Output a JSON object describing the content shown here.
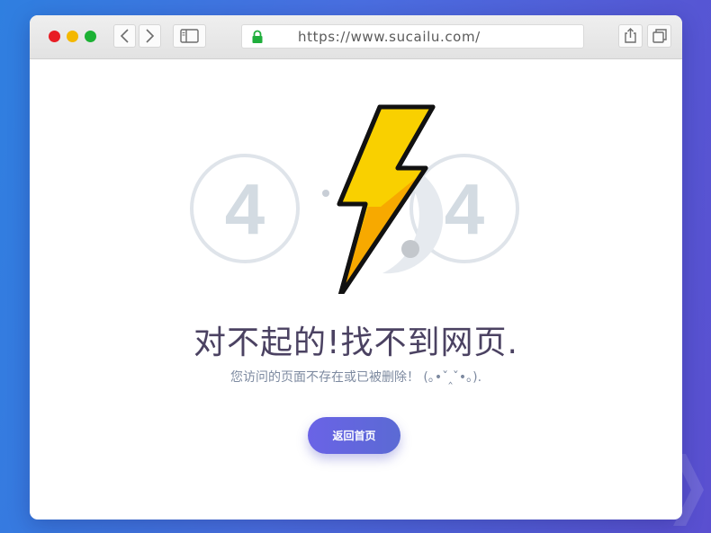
{
  "browser": {
    "url": "https://www.sucailu.com/"
  },
  "illustration": {
    "digits": [
      "4",
      "4"
    ]
  },
  "error": {
    "title": "对不起的!找不到网页.",
    "subtitle": "您访问的页面不存在或已被删除！ (｡•ˇ‸ˇ•｡)."
  },
  "actions": {
    "home_label": "返回首页"
  },
  "colors": {
    "accent": "#6a63e6",
    "bolt": "#f9d000",
    "bolt_shadow": "#f7a200",
    "circle_outline": "#dfe4ea",
    "digit": "#d3dbe2"
  },
  "icons": {
    "back": "chevron-left-icon",
    "forward": "chevron-right-icon",
    "sidebar": "sidebar-icon",
    "lock": "lock-icon",
    "share": "share-icon",
    "tabs": "tabs-icon",
    "hero": "lightning-bolt-icon"
  }
}
